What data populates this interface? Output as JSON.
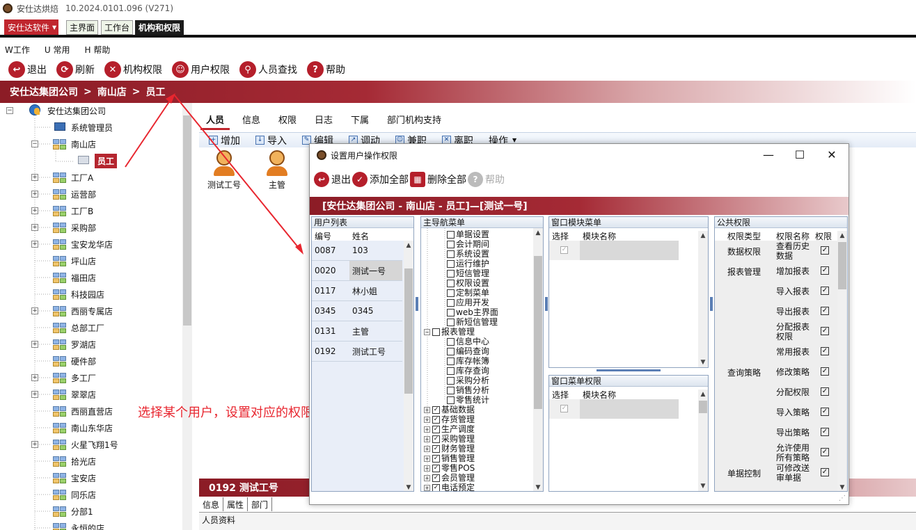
{
  "window": {
    "title": "安仕达烘焙",
    "version": "10.2024.0101.096 (V271)"
  },
  "brand_button": "安仕达软件",
  "top_tabs": [
    "主界面",
    "工作台",
    "机构和权限"
  ],
  "menubar": [
    "W工作",
    "U 常用",
    "H 帮助"
  ],
  "toolbar": [
    "退出",
    "刷新",
    "机构权限",
    "用户权限",
    "人员查找",
    "帮助"
  ],
  "breadcrumb": [
    "安仕达集团公司",
    ">",
    "南山店",
    ">",
    "员工"
  ],
  "tree": {
    "root": "安仕达集团公司",
    "items": [
      "系统管理员",
      "南山店",
      "员工",
      "工厂A",
      "运营部",
      "工厂B",
      "采购部",
      "宝安龙华店",
      "坪山店",
      "福田店",
      "科技园店",
      "西丽专属店",
      "总部工厂",
      "罗湖店",
      "硬件部",
      "多工厂",
      "翠翠店",
      "西丽直营店",
      "南山东华店",
      "火星飞翔1号",
      "拾光店",
      "宝安店",
      "同乐店",
      "分部1",
      "永恒的店"
    ]
  },
  "right_tabs": [
    "人员",
    "信息",
    "权限",
    "日志",
    "下属",
    "部门机构支持"
  ],
  "sub_toolbar": [
    "增加",
    "导入",
    "编辑",
    "调动",
    "兼职",
    "离职",
    "操作"
  ],
  "people": [
    "测试工号",
    "主管"
  ],
  "bottom_header": "0192  测试工号",
  "bottom_tabs": [
    "信息",
    "属性",
    "部门"
  ],
  "bottom_label": "人员资料",
  "annotation": "选择某个用户，设置对应的权限即可",
  "dialog": {
    "title": "设置用户操作权限",
    "toolbar": [
      "退出",
      "添加全部",
      "删除全部",
      "帮助"
    ],
    "banner": "[安仕达集团公司 - 南山店 - 员工]—[测试一号]",
    "user_list": {
      "title": "用户列表",
      "col_id": "编号",
      "col_name": "姓名",
      "rows": [
        [
          "0087",
          "103"
        ],
        [
          "0020",
          "测试一号"
        ],
        [
          "0117",
          "林小姐"
        ],
        [
          "0345",
          "0345"
        ],
        [
          "0131",
          "主管"
        ],
        [
          "0192",
          "测试工号"
        ]
      ]
    },
    "nav_menu": {
      "title": "主导航菜单",
      "items": [
        "单据设置",
        "会计期间",
        "系统设置",
        "运行维护",
        "短信管理",
        "权限设置",
        "定制菜单",
        "应用开发",
        "web主界面",
        "新短信管理",
        "报表管理",
        "信息中心",
        "编码查询",
        "库存帐簿",
        "库存查询",
        "采购分析",
        "销售分析",
        "零售统计",
        "基础数据",
        "存货管理",
        "生产调度",
        "采购管理",
        "财务管理",
        "销售管理",
        "零售POS",
        "会员管理",
        "电话预定"
      ]
    },
    "window_module": {
      "title": "窗口模块菜单",
      "col_select": "选择",
      "col_name": "模块名称"
    },
    "window_menu_perm": {
      "title": "窗口菜单权限",
      "col_select": "选择",
      "col_name": "模块名称"
    },
    "public_perm": {
      "title": "公共权限",
      "col_type": "权限类型",
      "col_name": "权限名称",
      "col_perm": "权限",
      "rows": [
        [
          "数据权限",
          "查看历史数据"
        ],
        [
          "报表管理",
          "增加报表"
        ],
        [
          "",
          "导入报表"
        ],
        [
          "",
          "导出报表"
        ],
        [
          "",
          "分配报表权限"
        ],
        [
          "",
          "常用报表"
        ],
        [
          "查询策略",
          "修改策略"
        ],
        [
          "",
          "分配权限"
        ],
        [
          "",
          "导入策略"
        ],
        [
          "",
          "导出策略"
        ],
        [
          "",
          "允许使用所有策略"
        ],
        [
          "单据控制",
          "可修改送审单据"
        ]
      ]
    }
  }
}
